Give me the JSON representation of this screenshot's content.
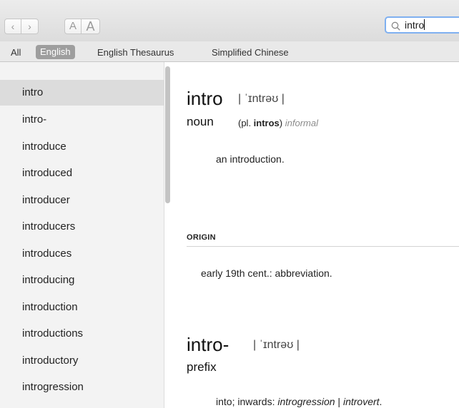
{
  "toolbar": {
    "back_glyph": "‹",
    "forward_glyph": "›",
    "font_smaller_label": "A",
    "font_larger_label": "A",
    "search": {
      "value": "intro",
      "icon": "search-icon"
    }
  },
  "sources": {
    "tabs": [
      "All",
      "English",
      "English Thesaurus",
      "Simplified Chinese"
    ],
    "selected": "English"
  },
  "sidebar": {
    "items": [
      {
        "label": "intro",
        "selected": true
      },
      {
        "label": "intro-"
      },
      {
        "label": "introduce"
      },
      {
        "label": "introduced"
      },
      {
        "label": "introducer"
      },
      {
        "label": "introducers"
      },
      {
        "label": "introduces"
      },
      {
        "label": "introducing"
      },
      {
        "label": "introduction"
      },
      {
        "label": "introductions"
      },
      {
        "label": "introductory"
      },
      {
        "label": "introgression"
      }
    ]
  },
  "entries": [
    {
      "headword": "intro",
      "pronunciation": "| ˈɪntrəʊ |",
      "part_of_speech": "noun",
      "grammar_pl": "(pl. ",
      "grammar_form": "intros",
      "grammar_close": ")",
      "register": "informal",
      "definition": "an introduction.",
      "origin_label": "ORIGIN",
      "origin_text": "early 19th cent.: abbreviation."
    },
    {
      "headword": "intro-",
      "pronunciation": "| ˈɪntrəʊ |",
      "part_of_speech": "prefix",
      "definition_lead": "into; inwards: ",
      "example_1": "introgression",
      "example_sep": " | ",
      "example_2": "introvert",
      "definition_end": "."
    }
  ],
  "colors": {
    "search_focus": "#7fb0f0",
    "selected_tab": "#9e9e9e",
    "sidebar_selected": "#dcdcdc"
  }
}
